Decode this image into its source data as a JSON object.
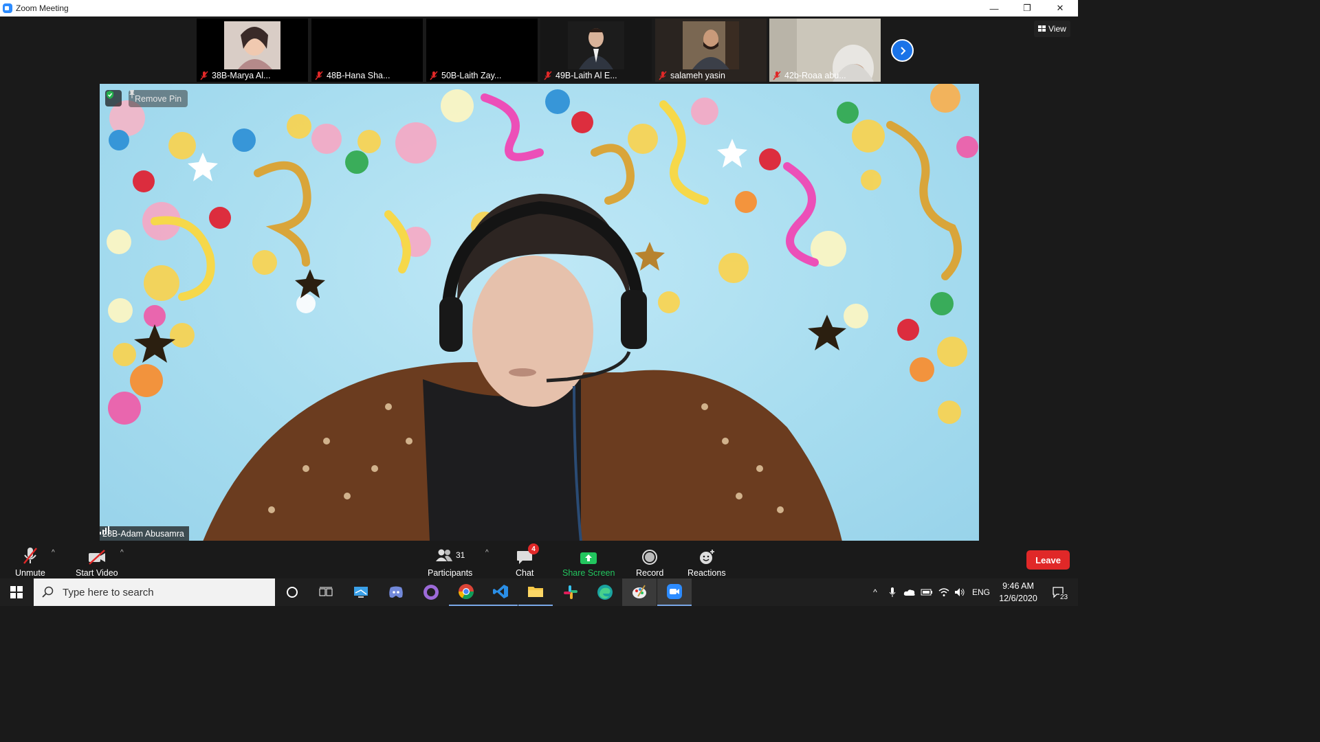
{
  "window": {
    "title": "Zoom Meeting",
    "minimize": "—",
    "restore": "❐",
    "close": "✕"
  },
  "gallery": {
    "participants": [
      {
        "name": "38B-Marya Al...",
        "video": "on",
        "muted": true
      },
      {
        "name": "48B-Hana Sha...",
        "video": "off",
        "muted": true
      },
      {
        "name": "50B-Laith Zay...",
        "video": "off",
        "muted": true
      },
      {
        "name": "49B-Laith Al E...",
        "video": "on",
        "muted": true
      },
      {
        "name": "salameh yasin",
        "video": "on",
        "muted": true
      },
      {
        "name": "42b-Roaa abu...",
        "video": "on",
        "muted": true
      }
    ],
    "next_icon": "chevron-right-icon",
    "view_label": "View"
  },
  "main": {
    "remove_pin_label": "Remove Pin",
    "speaker_name": "28B-Adam Abusamra"
  },
  "toolbar": {
    "unmute": "Unmute",
    "start_video": "Start Video",
    "participants_label": "Participants",
    "participants_count": "31",
    "chat": "Chat",
    "chat_badge": "4",
    "share_screen": "Share Screen",
    "record": "Record",
    "reactions": "Reactions",
    "leave": "Leave"
  },
  "taskbar": {
    "search_placeholder": "Type here to search",
    "language": "ENG",
    "time": "9:46 AM",
    "date": "12/6/2020",
    "notifications": "23"
  },
  "colors": {
    "accent": "#2D8CFF",
    "leave": "#E02828",
    "share_screen": "#22C55E",
    "toolbar_bg": "#1A1A1A",
    "backdrop": "#A6DCEF"
  }
}
